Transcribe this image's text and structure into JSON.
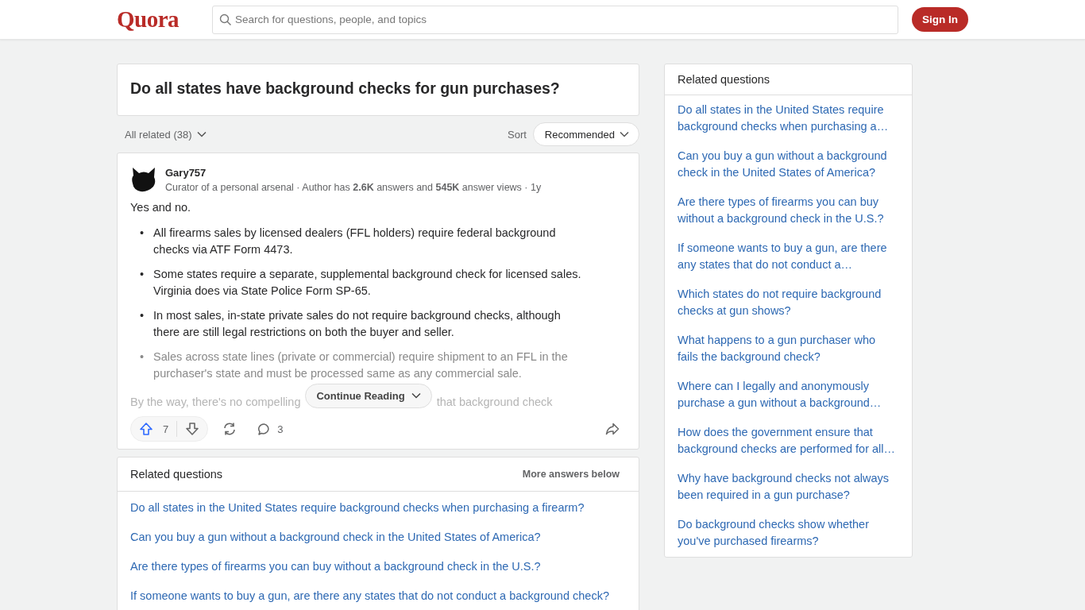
{
  "header": {
    "logo": "Quora",
    "search": {
      "placeholder": "Search for questions, people, and topics"
    },
    "sign_in": "Sign In"
  },
  "question": {
    "title": "Do all states have background checks for gun purchases?"
  },
  "filters": {
    "all_related": "All related (38)",
    "sort_label": "Sort",
    "sort_value": "Recommended"
  },
  "answer": {
    "author": "Gary757",
    "meta": "Curator of a personal arsenal · Author has **2.6K** answers and **545K** answer views · 1y",
    "intro": "Yes and no.",
    "bullet_marker": "•",
    "bullets": [
      {
        "text": "All firearms sales by licensed dealers (FFL holders) require federal background checks via ATF Form 4473.",
        "faded": false
      },
      {
        "text": "Some states require a separate, supplemental background check for licensed sales. Virginia does via State Police Form SP-65.",
        "faded": false
      },
      {
        "text": "In most sales, in-state private sales do not require background checks, although there are still legal restrictions on both the buyer and seller.",
        "faded": false
      },
      {
        "text": "Sales across state lines (private or commercial) require shipment to an FFL in the purchaser's state and must be processed same as any commercial sale.",
        "faded": true
      }
    ],
    "trailing_before": "By the way, there's no compelling",
    "trailing_after": "that background check",
    "continue": "Continue Reading",
    "upvotes": "7",
    "comments": "3"
  },
  "related_inline": {
    "title": "Related questions",
    "more": "More answers below",
    "items": [
      "Do all states in the United States require background checks when purchasing a firearm?",
      "Can you buy a gun without a background check in the United States of America?",
      "Are there types of firearms you can buy without a background check in the U.S.?",
      "If someone wants to buy a gun, are there any states that do not conduct a background check?"
    ]
  },
  "sidebar": {
    "title": "Related questions",
    "items": [
      "Do all states in the United States require background checks when purchasing a…",
      "Can you buy a gun without a background check in the United States of America?",
      "Are there types of firearms you can buy without a background check in the U.S.?",
      "If someone wants to buy a gun, are there any states that do not conduct a…",
      "Which states do not require background checks at gun shows?",
      "What happens to a gun purchaser who fails the background check?",
      "Where can I legally and anonymously purchase a gun without a background…",
      "How does the government ensure that background checks are performed for all…",
      "Why have background checks not always been required in a gun purchase?",
      "Do background checks show whether you've purchased firearms?"
    ]
  }
}
